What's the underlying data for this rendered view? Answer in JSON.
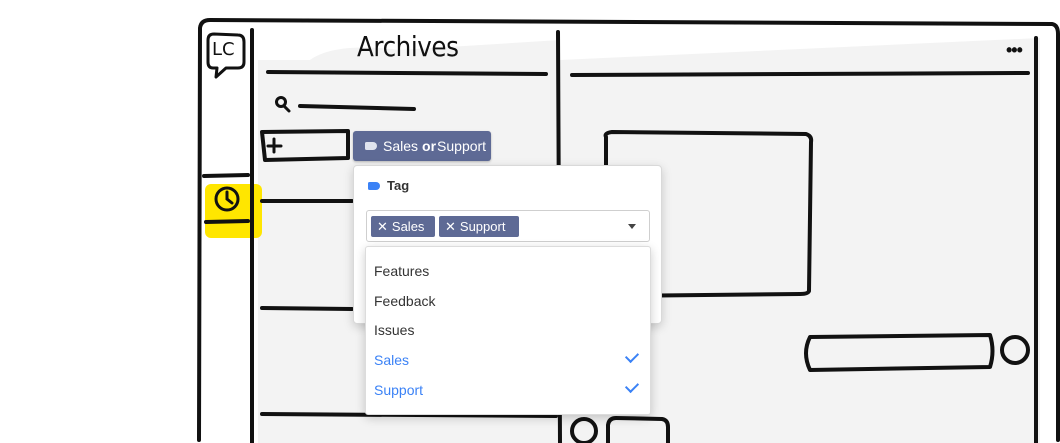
{
  "header": {
    "title": "Archives",
    "logo_text": "LC",
    "more_label": "•••"
  },
  "filter": {
    "label_left": "Sales",
    "operator": "or",
    "label_right": "Support"
  },
  "popover": {
    "heading": "Tag",
    "selected": [
      {
        "label": "Sales",
        "remove": "✕"
      },
      {
        "label": "Support",
        "remove": "✕"
      }
    ]
  },
  "menu": {
    "options": [
      {
        "label": "Features",
        "selected": false
      },
      {
        "label": "Feedback",
        "selected": false
      },
      {
        "label": "Issues",
        "selected": false
      },
      {
        "label": "Sales",
        "selected": true
      },
      {
        "label": "Support",
        "selected": true
      }
    ]
  },
  "colors": {
    "accent": "#5e6a95",
    "selected_text": "#3b82f6",
    "highlight": "#ffe600",
    "panel_bg": "#f4f4f4",
    "ink": "#111111"
  },
  "icons": {
    "search": "search-icon",
    "add": "plus-icon",
    "clock": "clock-icon",
    "tag": "tag-icon",
    "menu": "more-icon"
  }
}
